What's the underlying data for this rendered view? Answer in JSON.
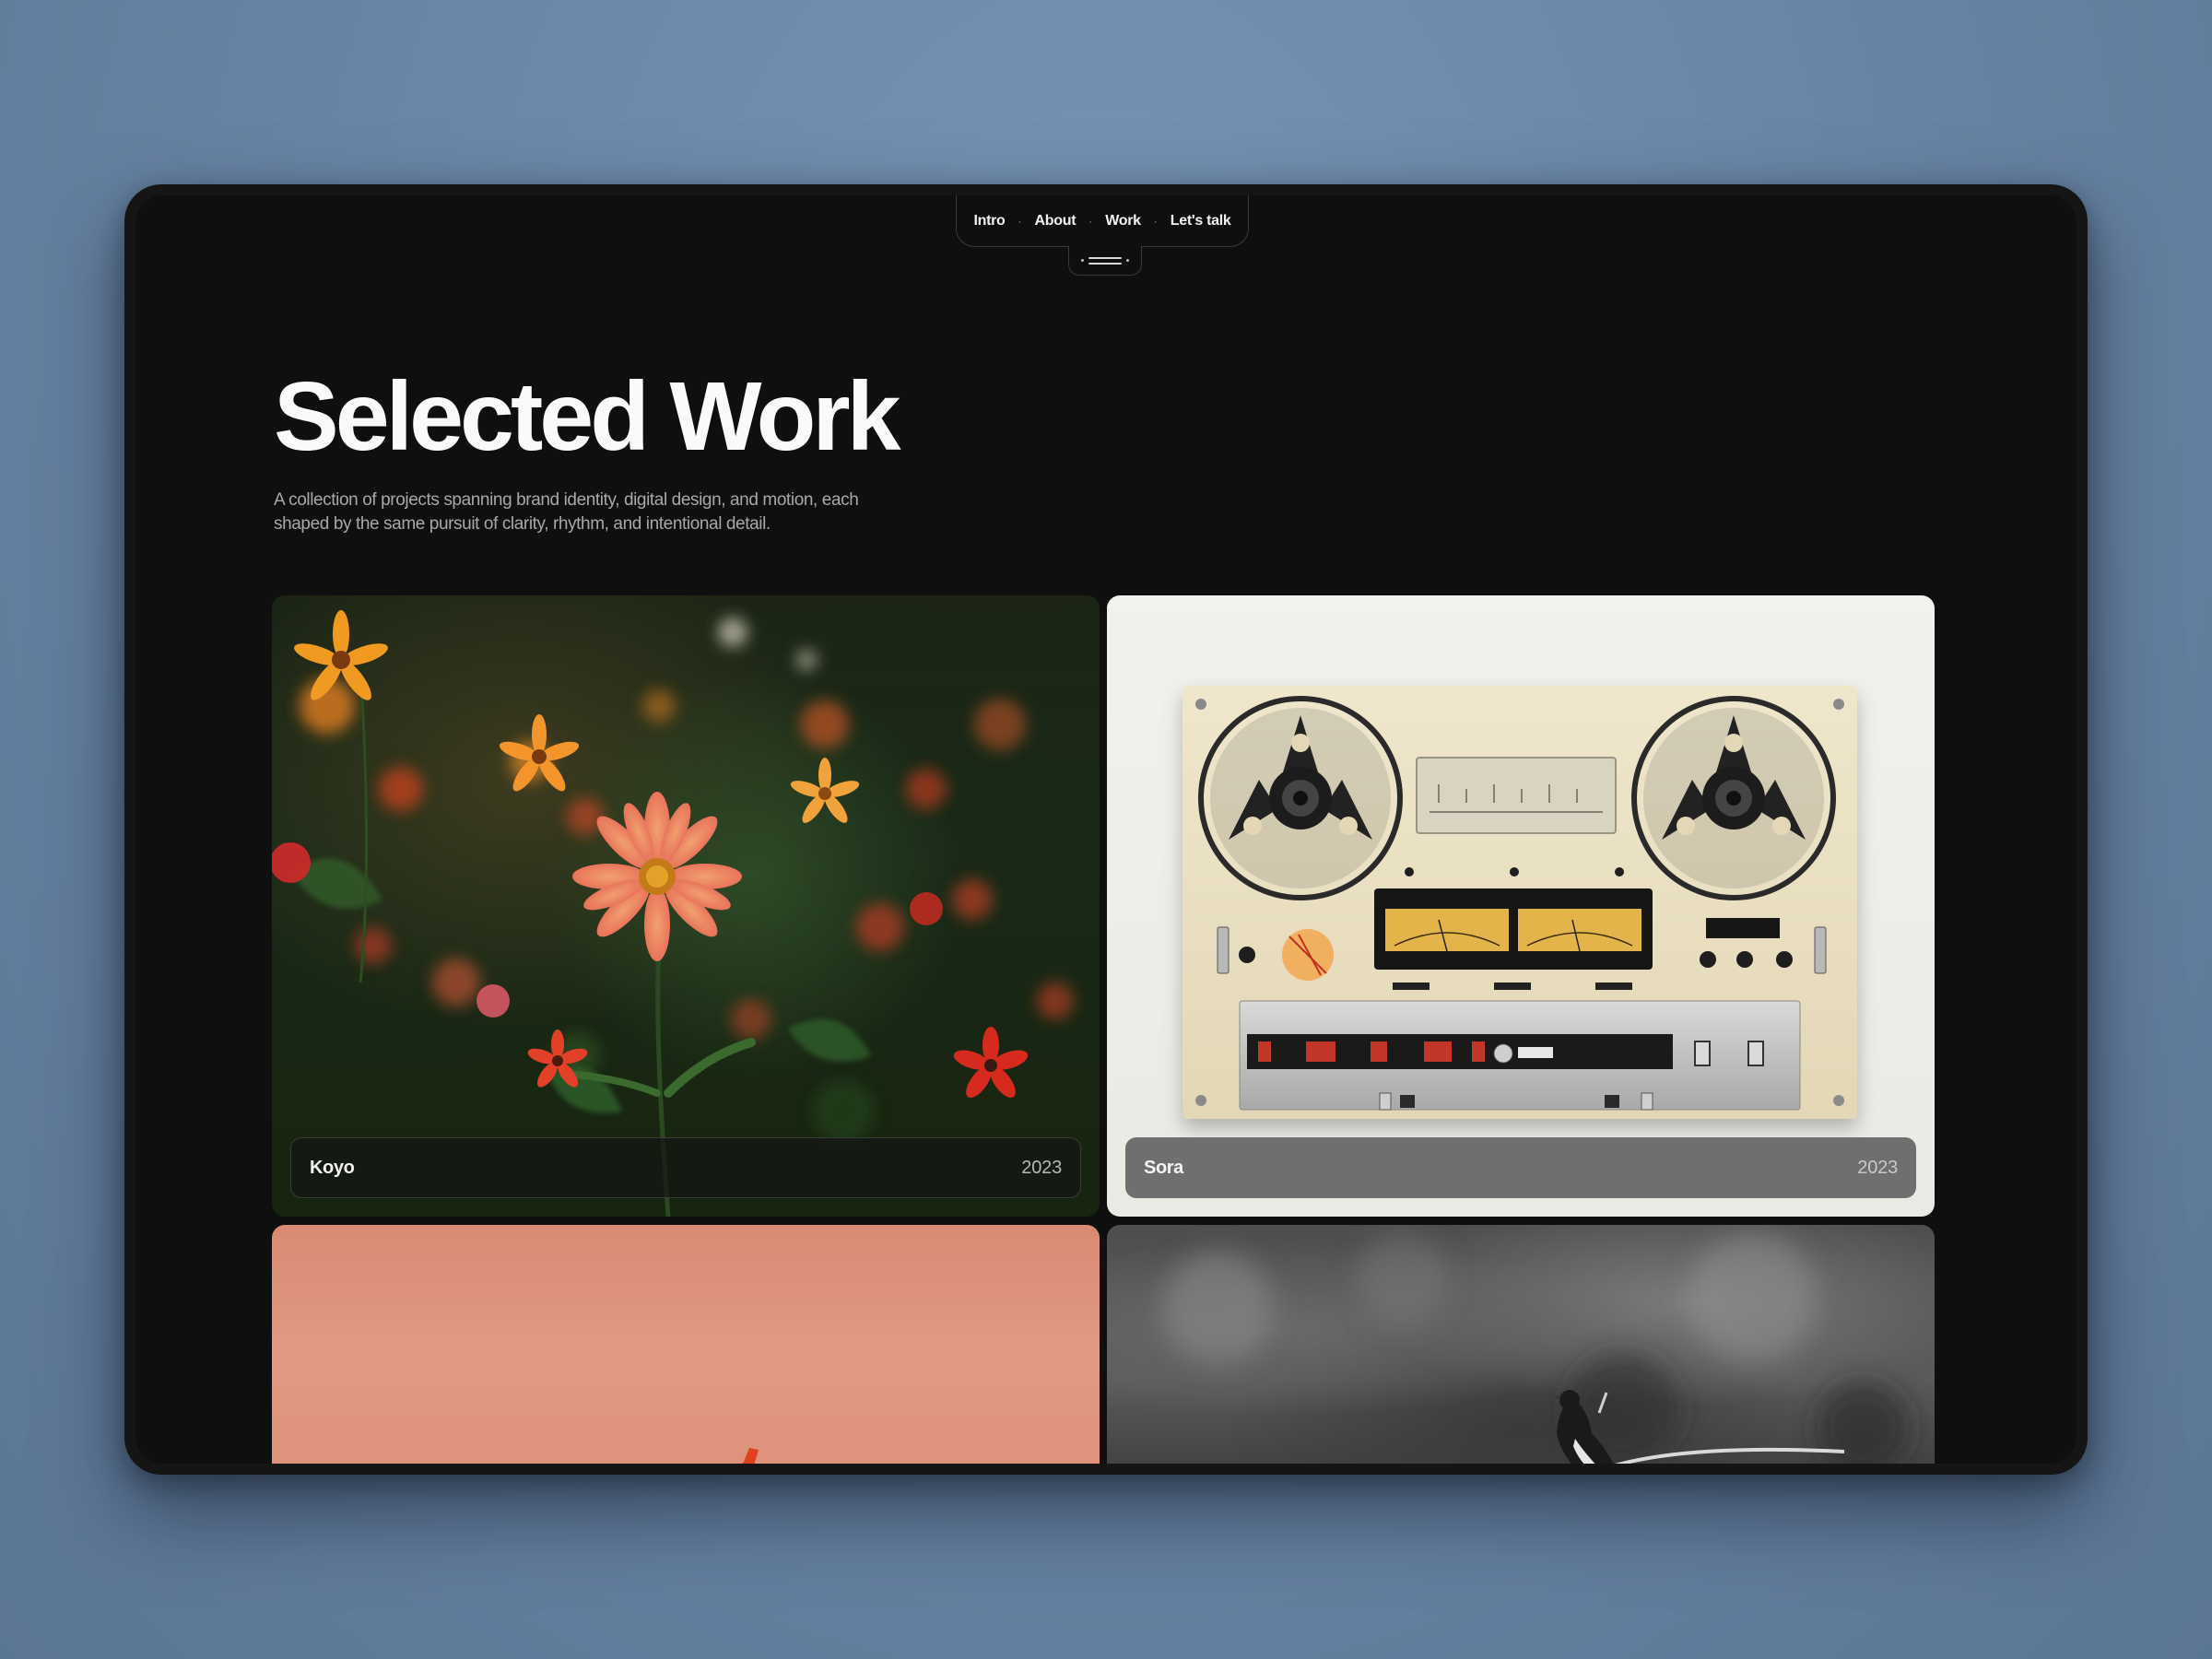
{
  "nav": {
    "items": [
      {
        "label": "Intro"
      },
      {
        "label": "About"
      },
      {
        "label": "Work"
      },
      {
        "label": "Let's talk"
      }
    ],
    "separator": "·",
    "menu_icon": "menu-handle-icon"
  },
  "hero": {
    "title": "Selected Work",
    "subtitle": "A collection of projects spanning brand identity, digital design, and motion, each shaped by the same pursuit of clarity, rhythm, and intentional detail."
  },
  "projects": [
    {
      "name": "Koyo",
      "year": "2023",
      "image": "flower-field-image"
    },
    {
      "name": "Sora",
      "year": "2023",
      "image": "reel-to-reel-tape-deck-image"
    },
    {
      "image": "coral-still-life-image"
    },
    {
      "image": "bird-on-branch-image"
    }
  ],
  "colors": {
    "backdrop": "#6a86a6",
    "device": "#151515",
    "screen": "#0f0f0f",
    "text_primary": "#fafafa",
    "text_muted": "#a8a8a8",
    "coral": "#e29983"
  }
}
